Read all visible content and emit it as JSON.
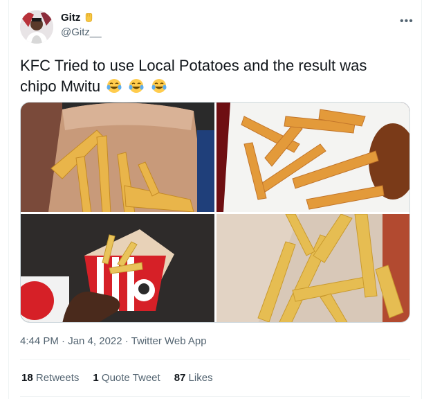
{
  "author": {
    "name": "Gitz",
    "handle": "@Gitz__",
    "badge_icon": "raised-fist-emoji"
  },
  "more_icon": "•••",
  "tweet": {
    "text": "KFC Tried to use Local Potatoes and the result was chipo Mwitu",
    "emojis": [
      "face-with-tears-of-joy",
      "face-with-tears-of-joy",
      "face-with-tears-of-joy"
    ]
  },
  "meta": "4:44 PM · Jan 4, 2022 · Twitter Web App",
  "stats": {
    "retweets_count": "18",
    "retweets_label": "Retweets",
    "quotes_count": "1",
    "quotes_label": "Quote Tweet",
    "likes_count": "87",
    "likes_label": "Likes"
  },
  "colors": {
    "text": "#0f1419",
    "muted": "#536471",
    "border": "#eff3f4",
    "kfc_red": "#d62027"
  }
}
